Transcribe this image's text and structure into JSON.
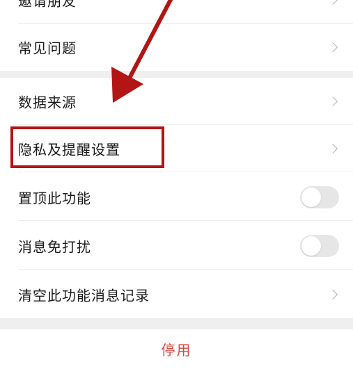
{
  "settings": {
    "items": [
      {
        "label": "邀请朋友",
        "control": "chevron"
      },
      {
        "label": "常见问题",
        "control": "chevron"
      },
      {
        "label": "数据来源",
        "control": "chevron"
      },
      {
        "label": "隐私及提醒设置",
        "control": "chevron"
      },
      {
        "label": "置顶此功能",
        "control": "toggle",
        "state": "off"
      },
      {
        "label": "消息免打扰",
        "control": "toggle",
        "state": "off"
      },
      {
        "label": "清空此功能消息记录",
        "control": "chevron"
      }
    ],
    "disable_label": "停用"
  },
  "annotation": {
    "color": "#b31414",
    "target": "隐私及提醒设置"
  },
  "colors": {
    "destructive": "#d9453a",
    "section_gap": "#efefef",
    "toggle_off": "#e6e6e6"
  }
}
